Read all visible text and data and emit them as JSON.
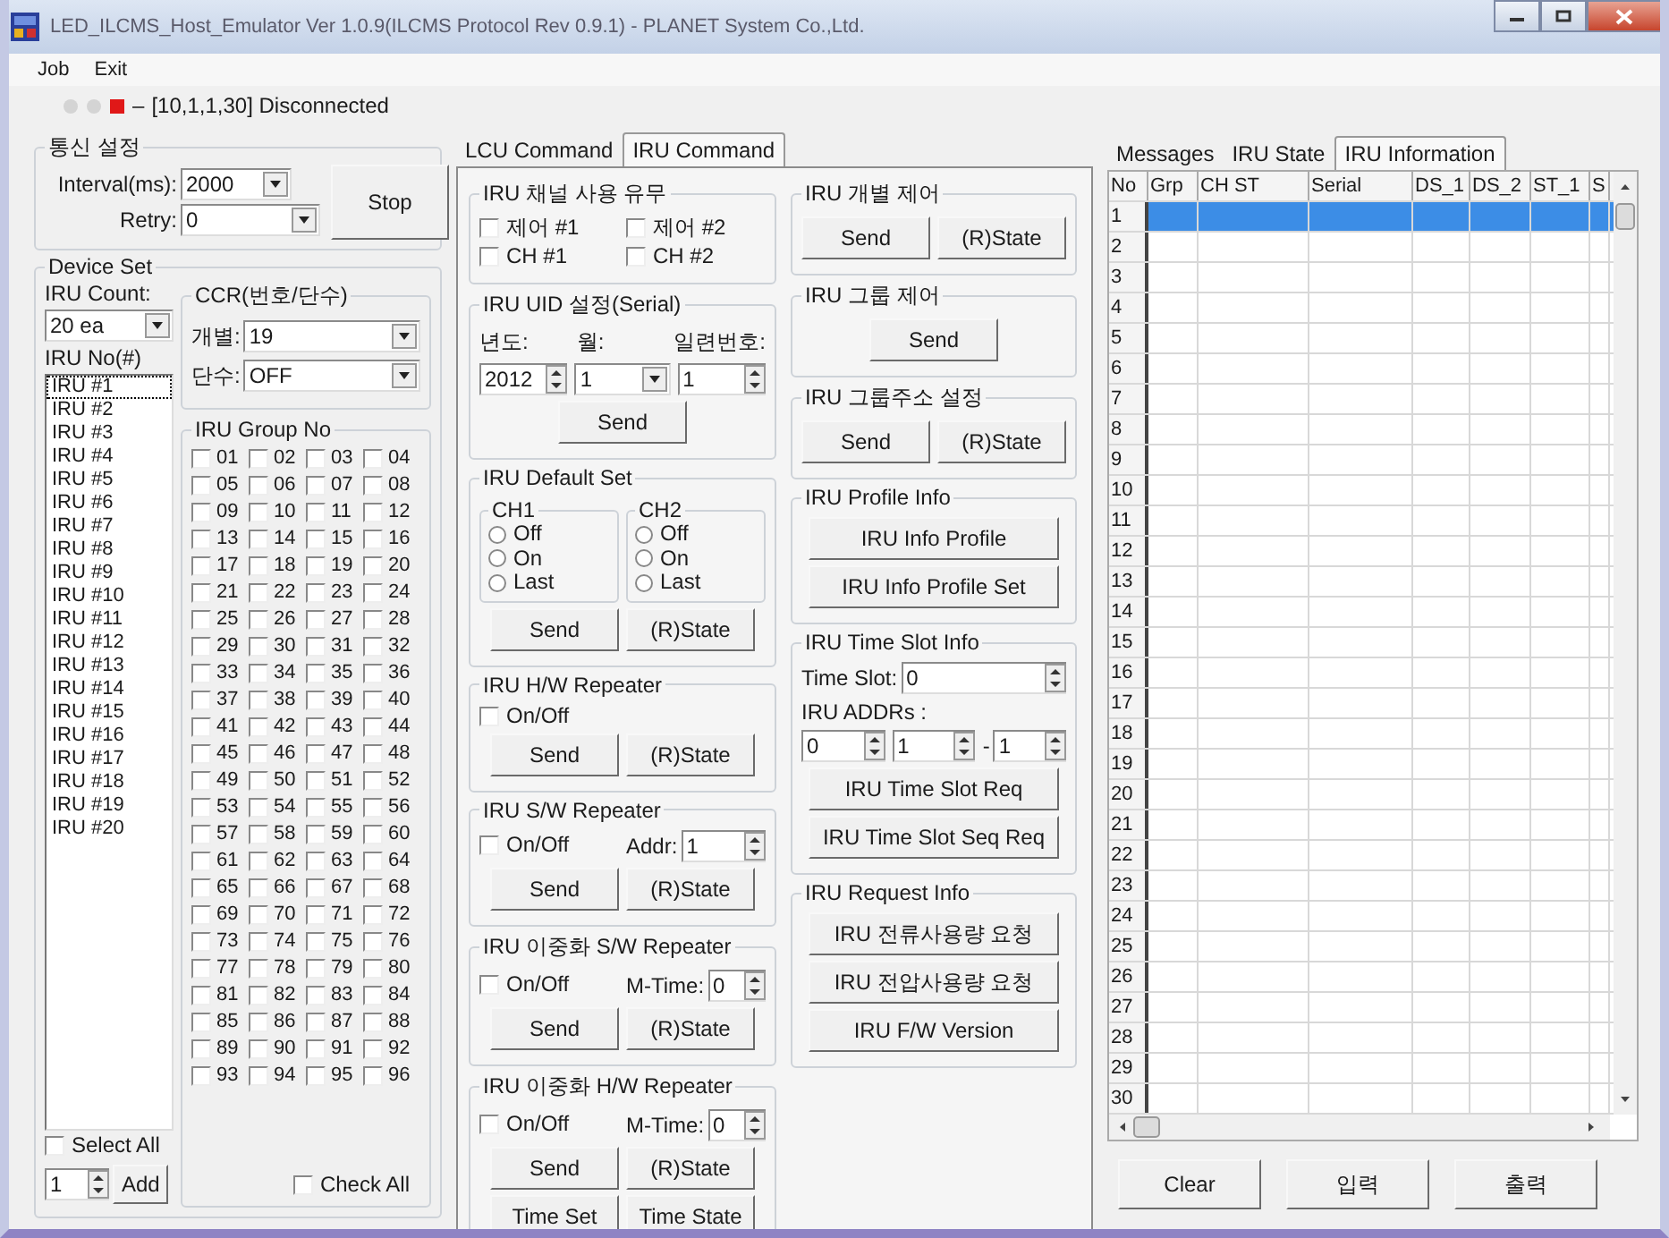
{
  "window": {
    "title": "LED_ILCMS_Host_Emulator Ver 1.0.9(ILCMS Protocol Rev 0.9.1) - PLANET System Co.,Ltd."
  },
  "menu": [
    "Job",
    "Exit"
  ],
  "status": {
    "indicators": [
      {
        "kind": "circle",
        "color": "#d4d4d4"
      },
      {
        "kind": "circle",
        "color": "#d4d4d4"
      },
      {
        "kind": "square",
        "color": "#e01818"
      }
    ],
    "separator": "–",
    "text": "[10,1,1,30] Disconnected"
  },
  "comm": {
    "title": "통신 설정",
    "interval_label": "Interval(ms):",
    "interval_value": "2000",
    "retry_label": "Retry:",
    "retry_value": "0",
    "button": "Stop"
  },
  "device_set": {
    "title": "Device Set",
    "count_label": "IRU Count:",
    "count_value": "20 ea",
    "no_label": "IRU No(#)",
    "iru_list": [
      {
        "label": "IRU #1",
        "selected": true
      },
      {
        "label": "IRU #2",
        "selected": false
      },
      {
        "label": "IRU #3",
        "selected": false
      },
      {
        "label": "IRU #4",
        "selected": false
      },
      {
        "label": "IRU #5",
        "selected": false
      },
      {
        "label": "IRU #6",
        "selected": false
      },
      {
        "label": "IRU #7",
        "selected": false
      },
      {
        "label": "IRU #8",
        "selected": false
      },
      {
        "label": "IRU #9",
        "selected": false
      },
      {
        "label": "IRU #10",
        "selected": false
      },
      {
        "label": "IRU #11",
        "selected": false
      },
      {
        "label": "IRU #12",
        "selected": false
      },
      {
        "label": "IRU #13",
        "selected": false
      },
      {
        "label": "IRU #14",
        "selected": false
      },
      {
        "label": "IRU #15",
        "selected": false
      },
      {
        "label": "IRU #16",
        "selected": false
      },
      {
        "label": "IRU #17",
        "selected": false
      },
      {
        "label": "IRU #18",
        "selected": false
      },
      {
        "label": "IRU #19",
        "selected": false
      },
      {
        "label": "IRU #20",
        "selected": false
      }
    ],
    "ccr": {
      "title": "CCR(번호/단수)",
      "fields": [
        {
          "label": "개별:",
          "value": "19"
        },
        {
          "label": "단수:",
          "value": "OFF"
        }
      ]
    },
    "group_no": {
      "title": "IRU Group No",
      "items": [
        {
          "label": "01",
          "checked": false
        },
        {
          "label": "02",
          "checked": false
        },
        {
          "label": "03",
          "checked": false
        },
        {
          "label": "04",
          "checked": false
        },
        {
          "label": "05",
          "checked": false
        },
        {
          "label": "06",
          "checked": false
        },
        {
          "label": "07",
          "checked": false
        },
        {
          "label": "08",
          "checked": false
        },
        {
          "label": "09",
          "checked": false
        },
        {
          "label": "10",
          "checked": false
        },
        {
          "label": "11",
          "checked": false
        },
        {
          "label": "12",
          "checked": false
        },
        {
          "label": "13",
          "checked": false
        },
        {
          "label": "14",
          "checked": false
        },
        {
          "label": "15",
          "checked": false
        },
        {
          "label": "16",
          "checked": false
        },
        {
          "label": "17",
          "checked": false
        },
        {
          "label": "18",
          "checked": false
        },
        {
          "label": "19",
          "checked": false
        },
        {
          "label": "20",
          "checked": false
        },
        {
          "label": "21",
          "checked": false
        },
        {
          "label": "22",
          "checked": false
        },
        {
          "label": "23",
          "checked": false
        },
        {
          "label": "24",
          "checked": false
        },
        {
          "label": "25",
          "checked": false
        },
        {
          "label": "26",
          "checked": false
        },
        {
          "label": "27",
          "checked": false
        },
        {
          "label": "28",
          "checked": false
        },
        {
          "label": "29",
          "checked": false
        },
        {
          "label": "30",
          "checked": false
        },
        {
          "label": "31",
          "checked": false
        },
        {
          "label": "32",
          "checked": false
        },
        {
          "label": "33",
          "checked": false
        },
        {
          "label": "34",
          "checked": false
        },
        {
          "label": "35",
          "checked": false
        },
        {
          "label": "36",
          "checked": false
        },
        {
          "label": "37",
          "checked": false
        },
        {
          "label": "38",
          "checked": false
        },
        {
          "label": "39",
          "checked": false
        },
        {
          "label": "40",
          "checked": false
        },
        {
          "label": "41",
          "checked": false
        },
        {
          "label": "42",
          "checked": false
        },
        {
          "label": "43",
          "checked": false
        },
        {
          "label": "44",
          "checked": false
        },
        {
          "label": "45",
          "checked": false
        },
        {
          "label": "46",
          "checked": false
        },
        {
          "label": "47",
          "checked": false
        },
        {
          "label": "48",
          "checked": false
        },
        {
          "label": "49",
          "checked": false
        },
        {
          "label": "50",
          "checked": false
        },
        {
          "label": "51",
          "checked": false
        },
        {
          "label": "52",
          "checked": false
        },
        {
          "label": "53",
          "checked": false
        },
        {
          "label": "54",
          "checked": false
        },
        {
          "label": "55",
          "checked": false
        },
        {
          "label": "56",
          "checked": false
        },
        {
          "label": "57",
          "checked": false
        },
        {
          "label": "58",
          "checked": false
        },
        {
          "label": "59",
          "checked": false
        },
        {
          "label": "60",
          "checked": false
        },
        {
          "label": "61",
          "checked": false
        },
        {
          "label": "62",
          "checked": false
        },
        {
          "label": "63",
          "checked": false
        },
        {
          "label": "64",
          "checked": false
        },
        {
          "label": "65",
          "checked": false
        },
        {
          "label": "66",
          "checked": false
        },
        {
          "label": "67",
          "checked": false
        },
        {
          "label": "68",
          "checked": false
        },
        {
          "label": "69",
          "checked": false
        },
        {
          "label": "70",
          "checked": false
        },
        {
          "label": "71",
          "checked": false
        },
        {
          "label": "72",
          "checked": false
        },
        {
          "label": "73",
          "checked": false
        },
        {
          "label": "74",
          "checked": false
        },
        {
          "label": "75",
          "checked": false
        },
        {
          "label": "76",
          "checked": false
        },
        {
          "label": "77",
          "checked": false
        },
        {
          "label": "78",
          "checked": false
        },
        {
          "label": "79",
          "checked": false
        },
        {
          "label": "80",
          "checked": false
        },
        {
          "label": "81",
          "checked": false
        },
        {
          "label": "82",
          "checked": false
        },
        {
          "label": "83",
          "checked": false
        },
        {
          "label": "84",
          "checked": false
        },
        {
          "label": "85",
          "checked": false
        },
        {
          "label": "86",
          "checked": false
        },
        {
          "label": "87",
          "checked": false
        },
        {
          "label": "88",
          "checked": false
        },
        {
          "label": "89",
          "checked": false
        },
        {
          "label": "90",
          "checked": false
        },
        {
          "label": "91",
          "checked": false
        },
        {
          "label": "92",
          "checked": false
        },
        {
          "label": "93",
          "checked": false
        },
        {
          "label": "94",
          "checked": false
        },
        {
          "label": "95",
          "checked": false
        },
        {
          "label": "96",
          "checked": false
        }
      ],
      "check_all": {
        "label": "Check All",
        "checked": false
      }
    },
    "select_all": {
      "label": "Select All",
      "checked": false
    },
    "add_value": "1",
    "add_button": "Add"
  },
  "command_tabs": [
    {
      "label": "LCU Command",
      "selected": false
    },
    {
      "label": "IRU Command",
      "selected": true
    }
  ],
  "command_columns": [
    [
      {
        "title": "IRU 채널 사용 유무",
        "rows": [
          [
            {
              "kind": "checkbox",
              "label": "제어 #1",
              "checked": false
            },
            {
              "kind": "checkbox",
              "label": "제어 #2",
              "checked": false
            }
          ],
          [
            {
              "kind": "checkbox",
              "label": "CH #1",
              "checked": false
            },
            {
              "kind": "checkbox",
              "label": "CH #2",
              "checked": false
            }
          ]
        ]
      },
      {
        "title": "IRU UID 설정(Serial)",
        "rows": [
          [
            {
              "kind": "label",
              "text": "년도:"
            },
            {
              "kind": "label",
              "text": "월:"
            },
            {
              "kind": "label",
              "text": "일련번호:"
            }
          ],
          [
            {
              "kind": "spin",
              "value": "2012"
            },
            {
              "kind": "select",
              "value": "1"
            },
            {
              "kind": "spin",
              "value": "1"
            }
          ],
          [
            {
              "kind": "button",
              "label": "Send"
            }
          ]
        ]
      },
      {
        "title": "IRU Default Set",
        "rows": [
          [
            {
              "kind": "subgroup",
              "title": "CH1",
              "rows": [
                [
                  {
                    "kind": "radio",
                    "label": "Off",
                    "selected": false
                  }
                ],
                [
                  {
                    "kind": "radio",
                    "label": "On",
                    "selected": false
                  }
                ],
                [
                  {
                    "kind": "radio",
                    "label": "Last",
                    "selected": false
                  }
                ]
              ]
            },
            {
              "kind": "subgroup",
              "title": "CH2",
              "rows": [
                [
                  {
                    "kind": "radio",
                    "label": "Off",
                    "selected": false
                  }
                ],
                [
                  {
                    "kind": "radio",
                    "label": "On",
                    "selected": false
                  }
                ],
                [
                  {
                    "kind": "radio",
                    "label": "Last",
                    "selected": false
                  }
                ]
              ]
            }
          ],
          [
            {
              "kind": "button",
              "label": "Send"
            },
            {
              "kind": "button",
              "label": "(R)State"
            }
          ]
        ]
      },
      {
        "title": "IRU  H/W Repeater",
        "rows": [
          [
            {
              "kind": "checkbox",
              "label": "On/Off",
              "checked": false
            }
          ],
          [
            {
              "kind": "button",
              "label": "Send"
            },
            {
              "kind": "button",
              "label": "(R)State"
            }
          ]
        ]
      },
      {
        "title": "IRU S/W Repeater",
        "rows": [
          [
            {
              "kind": "checkbox",
              "label": "On/Off",
              "checked": false
            },
            {
              "kind": "spin",
              "label": "Addr:",
              "value": "1"
            }
          ],
          [
            {
              "kind": "button",
              "label": "Send"
            },
            {
              "kind": "button",
              "label": "(R)State"
            }
          ]
        ]
      },
      {
        "title": "IRU 이중화 S/W Repeater",
        "rows": [
          [
            {
              "kind": "checkbox",
              "label": "On/Off",
              "checked": false
            },
            {
              "kind": "spin",
              "label": "M-Time:",
              "value": "0"
            }
          ],
          [
            {
              "kind": "button",
              "label": "Send"
            },
            {
              "kind": "button",
              "label": "(R)State"
            }
          ]
        ]
      },
      {
        "title": "IRU 이중화 H/W Repeater",
        "rows": [
          [
            {
              "kind": "checkbox",
              "label": "On/Off",
              "checked": false
            },
            {
              "kind": "spin",
              "label": "M-Time:",
              "value": "0"
            }
          ],
          [
            {
              "kind": "button",
              "label": "Send"
            },
            {
              "kind": "button",
              "label": "(R)State"
            }
          ],
          [
            {
              "kind": "button",
              "label": "Time Set"
            },
            {
              "kind": "button",
              "label": "Time State"
            }
          ]
        ]
      }
    ],
    [
      {
        "title": "IRU 개별 제어",
        "rows": [
          [
            {
              "kind": "button",
              "label": "Send"
            },
            {
              "kind": "button",
              "label": "(R)State"
            }
          ]
        ]
      },
      {
        "title": "IRU 그룹 제어",
        "rows": [
          [
            {
              "kind": "button",
              "label": "Send"
            }
          ]
        ]
      },
      {
        "title": "IRU 그룹주소 설정",
        "rows": [
          [
            {
              "kind": "button",
              "label": "Send"
            },
            {
              "kind": "button",
              "label": "(R)State"
            }
          ]
        ]
      },
      {
        "title": "IRU Profile Info",
        "rows": [
          [
            {
              "kind": "wide_button",
              "label": "IRU Info Profile"
            }
          ],
          [
            {
              "kind": "wide_button",
              "label": "IRU Info Profile Set"
            }
          ]
        ]
      },
      {
        "title": "IRU Time Slot Info",
        "rows": [
          [
            {
              "kind": "spin",
              "label": "Time Slot:",
              "value": "0"
            }
          ],
          [
            {
              "kind": "label",
              "text": "IRU ADDRs :"
            }
          ],
          [
            {
              "kind": "spin",
              "value": "0"
            },
            {
              "kind": "spin",
              "value": "1"
            },
            {
              "kind": "spin",
              "label": "-",
              "value": "1"
            }
          ],
          [
            {
              "kind": "wide_button",
              "label": "IRU Time Slot Req"
            }
          ],
          [
            {
              "kind": "wide_button",
              "label": "IRU Time Slot Seq Req"
            }
          ]
        ]
      },
      {
        "title": "IRU Request Info",
        "rows": [
          [
            {
              "kind": "wide_button",
              "label": "IRU 전류사용량 요청"
            }
          ],
          [
            {
              "kind": "wide_button",
              "label": "IRU 전압사용량 요청"
            }
          ],
          [
            {
              "kind": "wide_button",
              "label": "IRU F/W Version"
            }
          ]
        ]
      }
    ]
  ],
  "info_tabs": [
    {
      "label": "Messages",
      "selected": false
    },
    {
      "label": "IRU State",
      "selected": false
    },
    {
      "label": "IRU Information",
      "selected": true
    }
  ],
  "table": {
    "columns": [
      "No",
      "Grp",
      "CH ST",
      "Serial",
      "DS_1",
      "DS_2",
      "ST_1",
      "S"
    ],
    "rows": [
      {
        "no": "1",
        "selected": true
      },
      {
        "no": "2",
        "selected": false
      },
      {
        "no": "3",
        "selected": false
      },
      {
        "no": "4",
        "selected": false
      },
      {
        "no": "5",
        "selected": false
      },
      {
        "no": "6",
        "selected": false
      },
      {
        "no": "7",
        "selected": false
      },
      {
        "no": "8",
        "selected": false
      },
      {
        "no": "9",
        "selected": false
      },
      {
        "no": "10",
        "selected": false
      },
      {
        "no": "11",
        "selected": false
      },
      {
        "no": "12",
        "selected": false
      },
      {
        "no": "13",
        "selected": false
      },
      {
        "no": "14",
        "selected": false
      },
      {
        "no": "15",
        "selected": false
      },
      {
        "no": "16",
        "selected": false
      },
      {
        "no": "17",
        "selected": false
      },
      {
        "no": "18",
        "selected": false
      },
      {
        "no": "19",
        "selected": false
      },
      {
        "no": "20",
        "selected": false
      },
      {
        "no": "21",
        "selected": false
      },
      {
        "no": "22",
        "selected": false
      },
      {
        "no": "23",
        "selected": false
      },
      {
        "no": "24",
        "selected": false
      },
      {
        "no": "25",
        "selected": false
      },
      {
        "no": "26",
        "selected": false
      },
      {
        "no": "27",
        "selected": false
      },
      {
        "no": "28",
        "selected": false
      },
      {
        "no": "29",
        "selected": false
      },
      {
        "no": "30",
        "selected": false
      }
    ]
  },
  "buttons": [
    "Clear",
    "입력",
    "출력"
  ]
}
